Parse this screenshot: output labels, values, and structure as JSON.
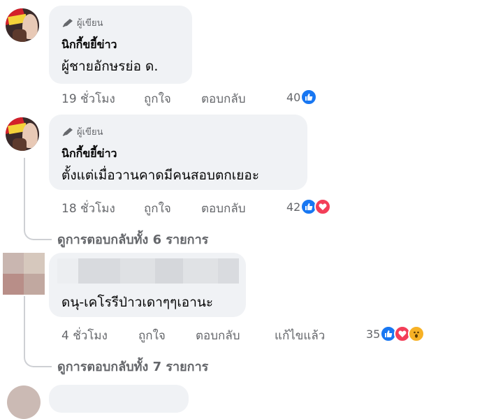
{
  "comments": [
    {
      "author_badge": "ผู้เขียน",
      "name": "นิกกี้ขยี้ข่าว",
      "text": "ผู้ชายอักษรย่อ ด.",
      "time": "19 ชั่วโมง",
      "like_label": "ถูกใจ",
      "reply_label": "ตอบกลับ",
      "reaction_count": "40",
      "reactions": [
        "like"
      ]
    },
    {
      "author_badge": "ผู้เขียน",
      "name": "นิกกี้ขยี้ข่าว",
      "text": "ตั้งแต่เมื่อวานคาดมีคนสอบตกเยอะ",
      "time": "18 ชั่วโมง",
      "like_label": "ถูกใจ",
      "reply_label": "ตอบกลับ",
      "reaction_count": "42",
      "reactions": [
        "like",
        "love"
      ],
      "view_replies": "ดูการตอบกลับทั้ง 6 รายการ"
    },
    {
      "text": "ดนุ-เคโรรีป่าวเดาๆๆเอานะ",
      "time": "4 ชั่วโมง",
      "like_label": "ถูกใจ",
      "reply_label": "ตอบกลับ",
      "edited_label": "แก้ไขแล้ว",
      "reaction_count": "35",
      "reactions": [
        "like",
        "love",
        "wow"
      ],
      "view_replies": "ดูการตอบกลับทั้ง 7 รายการ"
    }
  ],
  "colors": {
    "like": "#1877f2",
    "love": "#f33e58",
    "wow": "#f7b125",
    "bubble": "#f0f2f5",
    "meta": "#65676b"
  }
}
